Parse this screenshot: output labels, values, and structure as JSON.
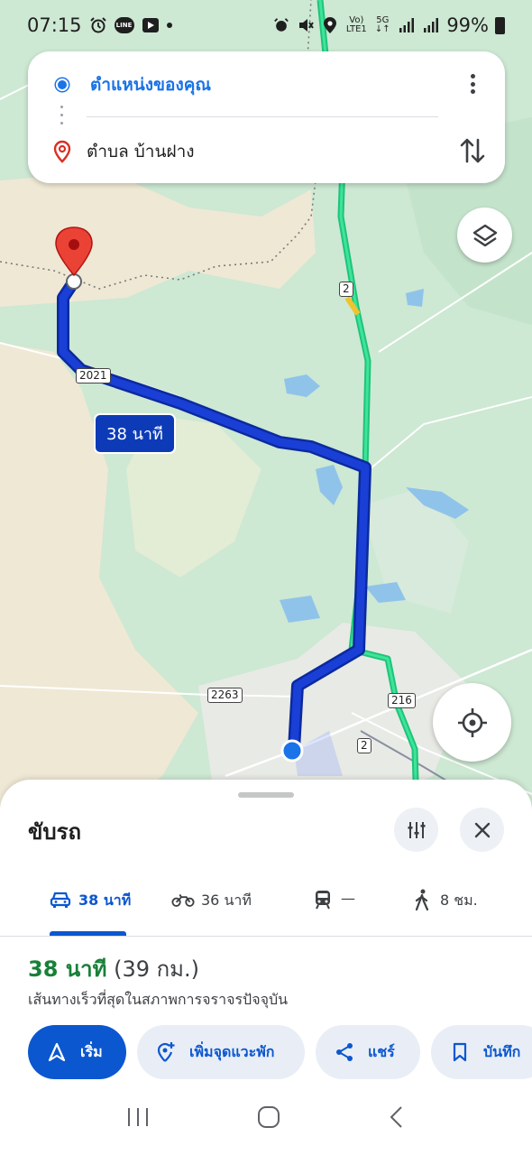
{
  "status_bar": {
    "time": "07:15",
    "line_badge": "LINE",
    "network_top": "Vo)",
    "network_bottom": "LTE1",
    "fiveg_top": "5G",
    "fiveg_bottom": "↓↑",
    "battery": "99%"
  },
  "search": {
    "origin": "ตำแหน่งของคุณ",
    "destination": "ตำบล บ้านฝาง"
  },
  "map": {
    "duration_label": "38 นาที",
    "road_labels": [
      "2",
      "2021",
      "2263",
      "216",
      "2"
    ]
  },
  "sheet": {
    "title": "ขับรถ",
    "modes": [
      {
        "name": "car",
        "label": "38 นาที"
      },
      {
        "name": "motorbike",
        "label": "36 นาที"
      },
      {
        "name": "transit",
        "label": "—"
      },
      {
        "name": "walk",
        "label": "8 ชม."
      }
    ],
    "summary_time": "38 นาที",
    "summary_distance": "(39 กม.)",
    "summary_desc": "เส้นทางเร็วที่สุดในสภาพการจราจรปัจจุบัน",
    "actions": {
      "start": "เริ่ม",
      "add_stop": "เพิ่มจุดแวะพัก",
      "share": "แชร์",
      "save": "บันทึก"
    }
  },
  "colors": {
    "route": "#1a3fd6",
    "highway": "#1ec47a",
    "accent": "#0b57d0",
    "green_time": "#188038",
    "map_bg": "#cfe9d5"
  }
}
